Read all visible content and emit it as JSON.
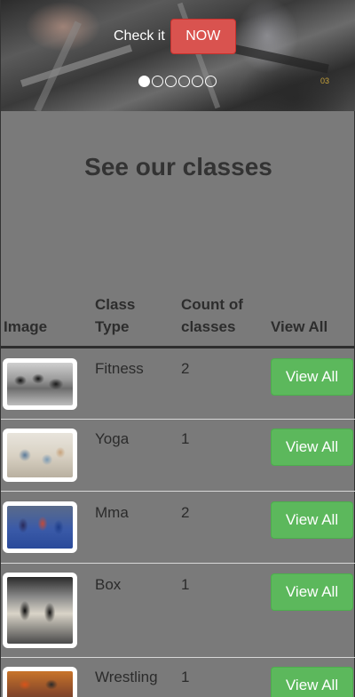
{
  "hero": {
    "cta_text": "Check it",
    "cta_button": "NOW",
    "slide_count": 6,
    "active_slide": 0
  },
  "section": {
    "title": "See our classes"
  },
  "table": {
    "headers": {
      "image": "Image",
      "type": "Class Type",
      "count": "Count of classes",
      "view": "View All"
    },
    "rows": [
      {
        "type": "Fitness",
        "count": "2",
        "button": "View All",
        "image_icon": "fitness-photo"
      },
      {
        "type": "Yoga",
        "count": "1",
        "button": "View All",
        "image_icon": "yoga-photo"
      },
      {
        "type": "Mma",
        "count": "2",
        "button": "View All",
        "image_icon": "mma-photo"
      },
      {
        "type": "Box",
        "count": "1",
        "button": "View All",
        "image_icon": "box-photo"
      },
      {
        "type": "Wrestling",
        "count": "1",
        "button": "View All",
        "image_icon": "wrestling-photo"
      }
    ]
  },
  "colors": {
    "background": "#7a7a7a",
    "cta_red": "#d9534f",
    "view_green": "#5cb85c"
  }
}
